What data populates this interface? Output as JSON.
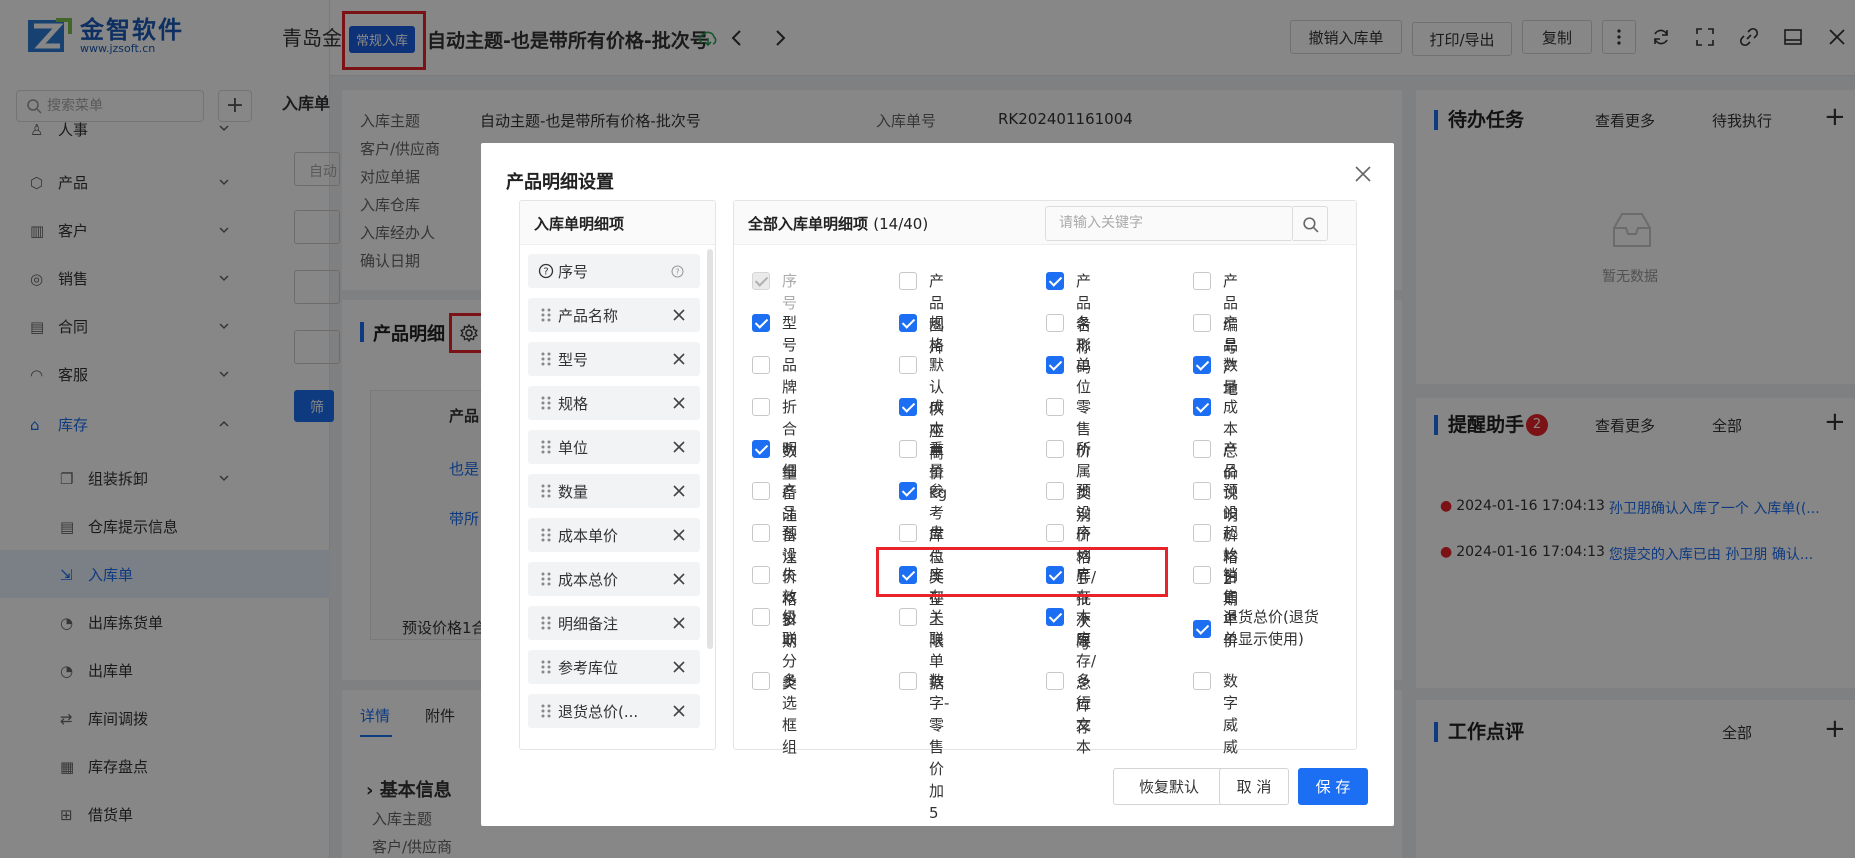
{
  "logo": {
    "name": "金智软件",
    "url": "www.jzsoft.cn"
  },
  "sidebar": {
    "search_placeholder": "搜索菜单",
    "items": [
      {
        "label": "人事",
        "icon": "person-icon"
      },
      {
        "label": "产品",
        "icon": "box-icon"
      },
      {
        "label": "客户",
        "icon": "building-icon"
      },
      {
        "label": "销售",
        "icon": "coin-icon"
      },
      {
        "label": "合同",
        "icon": "document-icon"
      },
      {
        "label": "客服",
        "icon": "headset-icon"
      },
      {
        "label": "库存",
        "icon": "warehouse-icon"
      }
    ],
    "sub_items": [
      {
        "label": "组装拆卸"
      },
      {
        "label": "仓库提示信息"
      },
      {
        "label": "入库单"
      },
      {
        "label": "出库拣货单"
      },
      {
        "label": "出库单"
      },
      {
        "label": "库间调拨"
      },
      {
        "label": "库存盘点"
      },
      {
        "label": "借货单"
      }
    ]
  },
  "topbar": {
    "company": "青岛金",
    "tag": "常规入库",
    "title": "自动主题-也是带所有价格-批次号",
    "buttons": {
      "revoke": "撤销入库单",
      "print": "打印/导出",
      "copy": "复制"
    }
  },
  "bg_form": {
    "section_label": "入库单",
    "fields": [
      {
        "label": "入库主题",
        "value": "自动主题-也是带所有价格-批次号"
      },
      {
        "label": "客户/供应商",
        "value": ""
      },
      {
        "label": "对应单据",
        "value": ""
      },
      {
        "label": "入库仓库",
        "value": ""
      },
      {
        "label": "入库经办人",
        "value": ""
      },
      {
        "label": "确认日期",
        "value": ""
      }
    ],
    "number_label": "入库单号",
    "number_value": "RK202401161004",
    "product_section": "产品明细",
    "filter_btn": "筛",
    "col_product": "产品",
    "rows": [
      "也是",
      "带所"
    ],
    "footer_cell": "预设价格1合",
    "tabs": [
      "详情",
      "附件"
    ],
    "basic_info": "基本信息",
    "basic_fields": [
      "入库主题",
      "客户/供应商"
    ],
    "auto_prefix": "自动"
  },
  "right_panel": {
    "todo": {
      "title": "待办任务",
      "more": "查看更多",
      "filter": "待我执行",
      "empty": "暂无数据"
    },
    "remind": {
      "title": "提醒助手",
      "badge": "2",
      "more": "查看更多",
      "filter": "全部",
      "items": [
        {
          "time": "2024-01-16 17:04:13",
          "text": "孙卫朋确认入库了一个 入库单((..."
        },
        {
          "time": "2024-01-16 17:04:13",
          "text": "您提交的入库已由 孙卫朋 确认..."
        }
      ]
    },
    "review": {
      "title": "工作点评",
      "filter": "全部"
    }
  },
  "modal": {
    "title": "产品明细设置",
    "left_title": "入库单明细项",
    "left_items": [
      "序号",
      "产品名称",
      "型号",
      "规格",
      "单位",
      "数量",
      "成本单价",
      "成本总价",
      "明细备注",
      "参考库位",
      "退货总价(..."
    ],
    "right_title": "全部入库单明细项",
    "count": "(14/40)",
    "search_placeholder": "请输入关键字",
    "options": [
      [
        "序号",
        "产品图片",
        "产品名称",
        "产品编号"
      ],
      [
        "型号",
        "规格",
        "条形码",
        "产品产地"
      ],
      [
        "品牌",
        "默认供应商",
        "单位",
        "数量"
      ],
      [
        "折合数量",
        "成本单价",
        "零售价",
        "成本总价"
      ],
      [
        "明细备注",
        "重量kg",
        "所属类别",
        "产品说明"
      ],
      [
        "产品备注",
        "参考库位",
        "预设价格1",
        "预设价格2"
      ],
      [
        "预设价格3",
        "盘点类型",
        "序列号/批次号",
        "起始日期"
      ],
      [
        "失效日期",
        "库存上限",
        "库存下限",
        "销售单价"
      ],
      [
        "级联分类",
        "关联单据",
        "本库存/总库存",
        "退货总价(退货单显示使用)"
      ],
      [
        "多选框组",
        "数字-零售价加5",
        "多行文本",
        "数字威威"
      ]
    ],
    "checked": [
      [
        1,
        0,
        1,
        0
      ],
      [
        1,
        1,
        0,
        0
      ],
      [
        0,
        0,
        1,
        1
      ],
      [
        0,
        1,
        0,
        1
      ],
      [
        1,
        0,
        0,
        0
      ],
      [
        0,
        1,
        0,
        0
      ],
      [
        0,
        0,
        0,
        0
      ],
      [
        0,
        1,
        1,
        0
      ],
      [
        0,
        0,
        1,
        1
      ],
      [
        0,
        0,
        0,
        0
      ]
    ],
    "buttons": {
      "reset": "恢复默认",
      "cancel": "取 消",
      "save": "保 存"
    }
  },
  "colors": {
    "accent": "#1c6ef2",
    "highlight": "#e8232a",
    "badge": "#e8232a"
  }
}
